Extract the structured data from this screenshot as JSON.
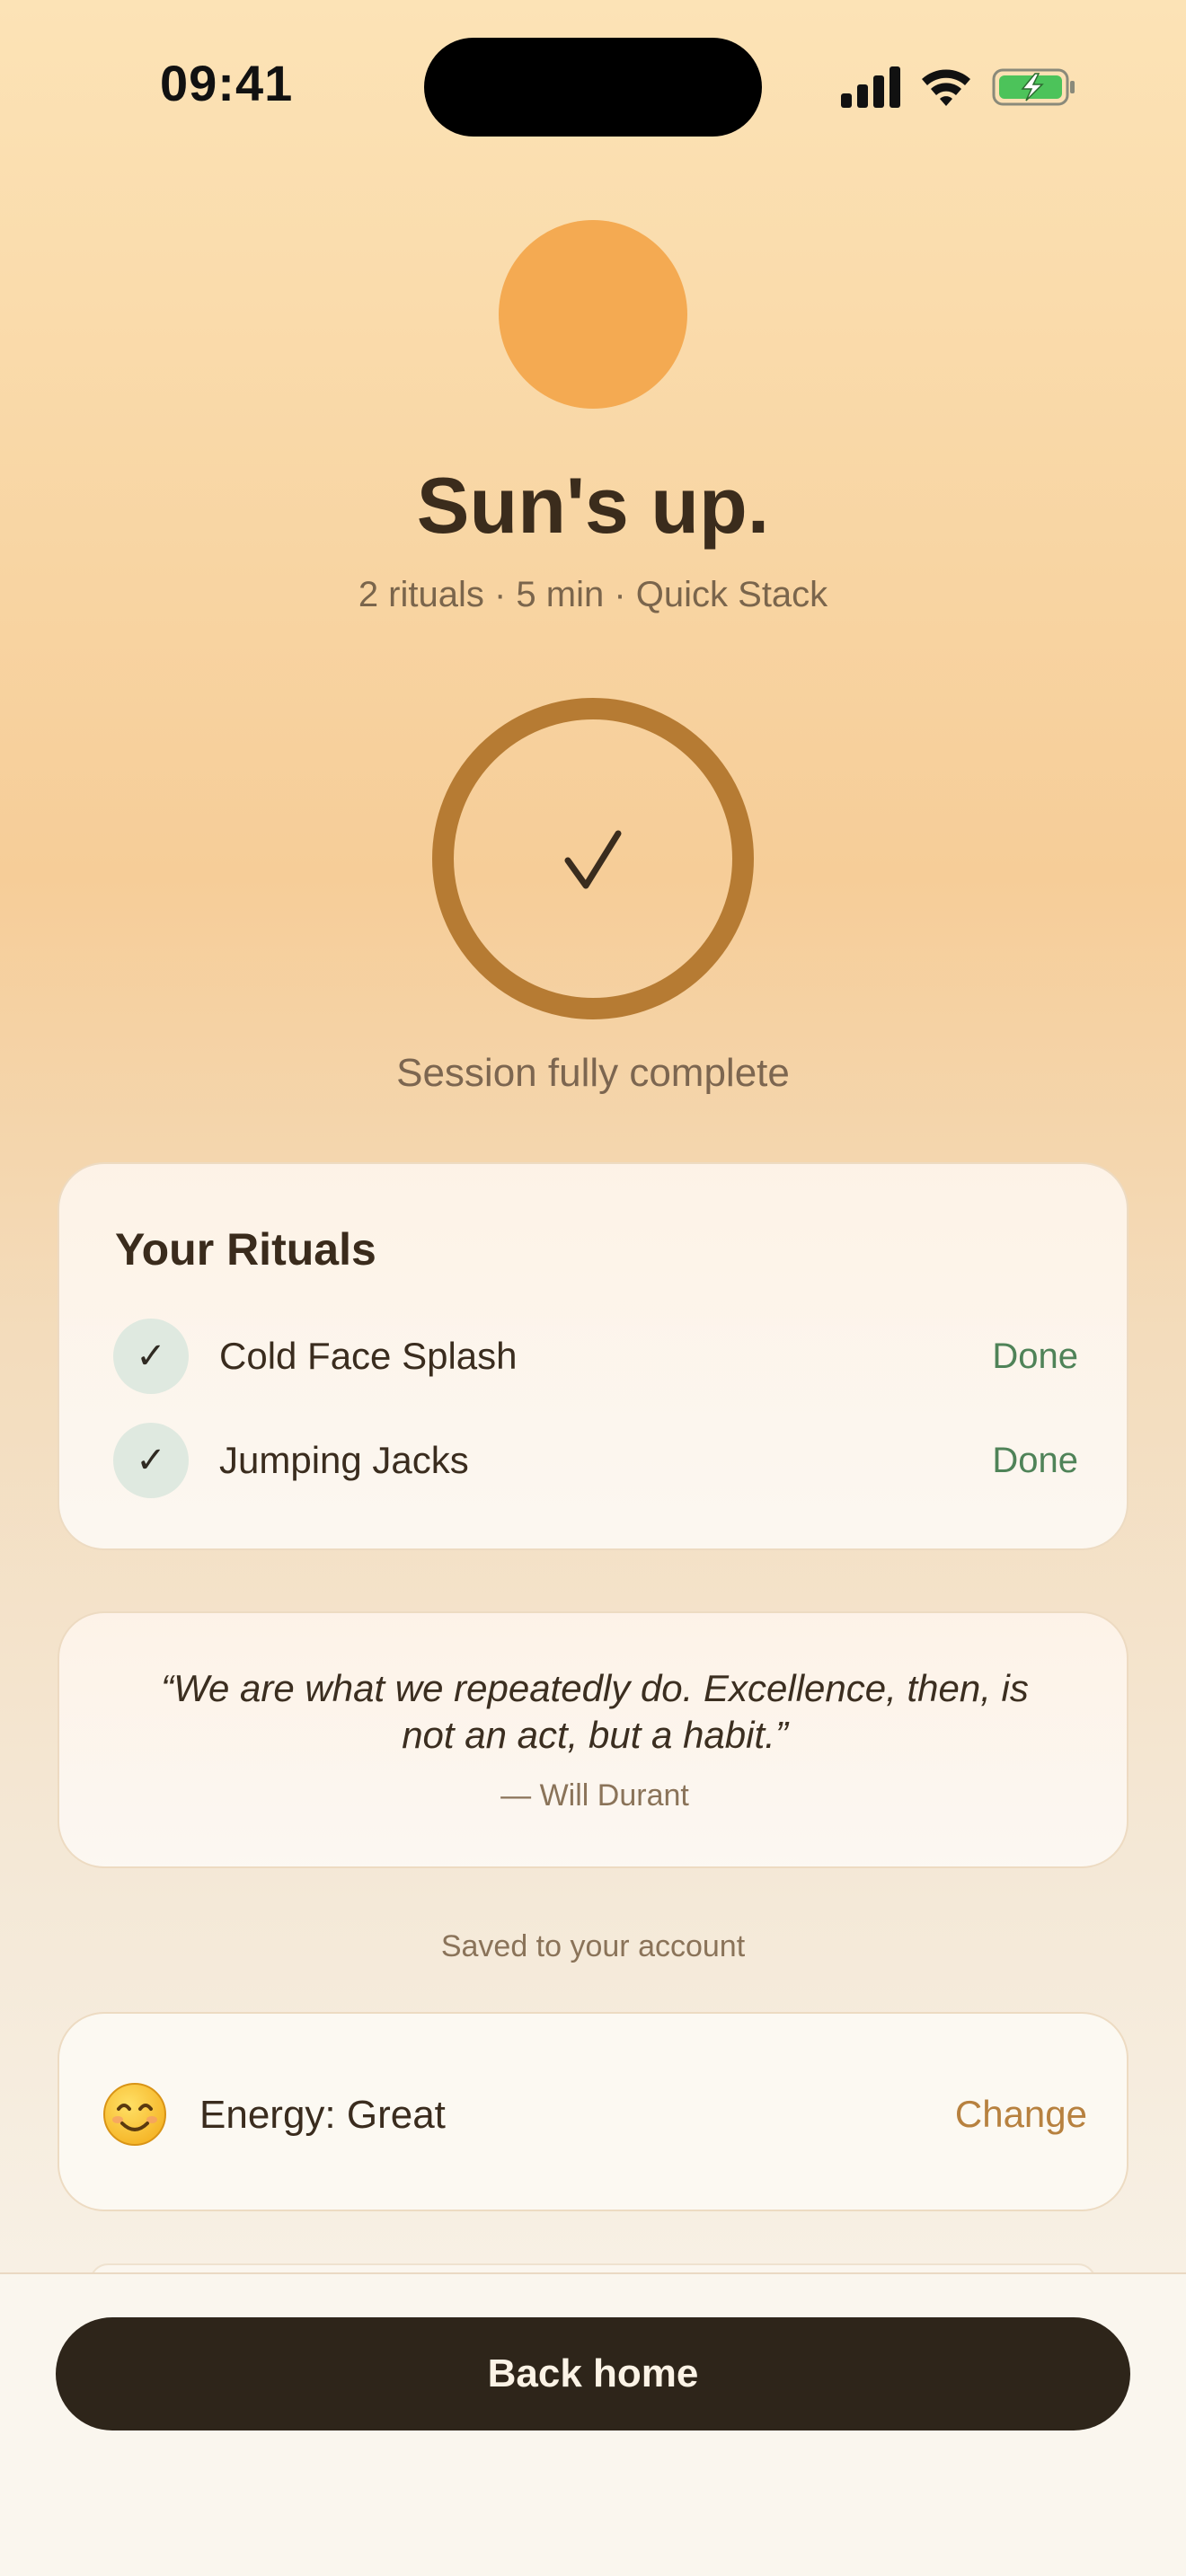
{
  "status_bar": {
    "time": "09:41",
    "signal_icon": "cellular-signal-icon",
    "wifi_icon": "wifi-icon",
    "battery_icon": "battery-charging-icon"
  },
  "hero": {
    "title": "Sun's up.",
    "subtitle": "2 rituals · 5 min · Quick Stack",
    "completion_caption": "Session fully complete",
    "completion_icon": "checkmark-icon",
    "completion_progress": 1.0
  },
  "rituals": {
    "title": "Your Rituals",
    "items": [
      {
        "name": "Cold Face Splash",
        "status": "Done",
        "check": "✓"
      },
      {
        "name": "Jumping Jacks",
        "status": "Done",
        "check": "✓"
      }
    ]
  },
  "quote": {
    "text": "“We are what we repeatedly do. Excellence, then, is not an act, but a habit.”",
    "author": "— Will Durant"
  },
  "saved_note": "Saved to your account",
  "energy": {
    "emoji_icon": "smiling-face-icon",
    "label": "Energy: Great",
    "change_label": "Change"
  },
  "footer": {
    "back_label": "Back home"
  },
  "colors": {
    "sun": "#f4aa52",
    "ring": "#b67b33",
    "done_green": "#4f8358",
    "accent_change": "#b7813f",
    "button_dark": "#2e251a"
  }
}
